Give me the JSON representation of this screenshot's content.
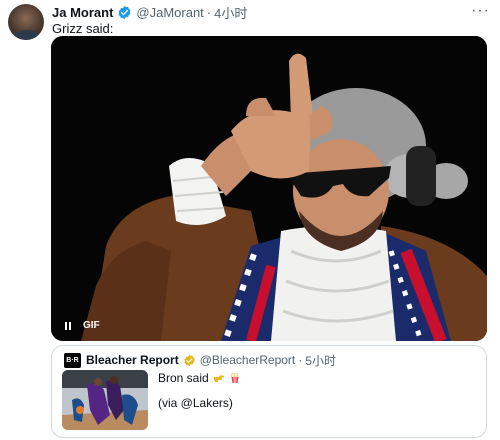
{
  "tweet": {
    "author_name": "Ja Morant",
    "author_handle": "@JaMorant",
    "separator": "·",
    "time": "4小时",
    "text": "Grizz said:",
    "more_label": "···",
    "media": {
      "type": "gif",
      "gif_label": "GIF"
    }
  },
  "quoted_tweet": {
    "logo_text": "B·R",
    "author_name": "Bleacher Report",
    "author_handle": "@BleacherReport",
    "separator": "·",
    "time": "5小时",
    "text": "Bron said",
    "emojis": [
      "pointing-hand-emoji",
      "popcorn-emoji"
    ],
    "via": "(via @Lakers)"
  },
  "colors": {
    "verified_blue": "#1d9bf0",
    "verified_gold": "#e2b719",
    "secondary_text": "#536471",
    "border": "#cfd9de"
  }
}
